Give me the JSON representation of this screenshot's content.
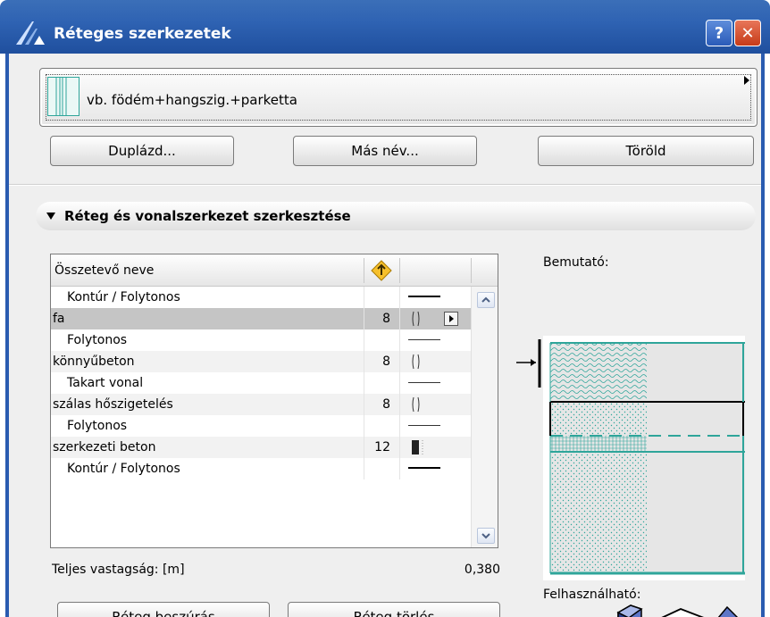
{
  "window": {
    "title": "Réteges szerkezetek",
    "help_label": "?",
    "close_label": "✕",
    "app_icon": "archicad-icon",
    "accent_color": "#2a5bb0"
  },
  "composite": {
    "name": "vb. födém+hangszig.+parketta",
    "swatch_icon": "composite-swatch-icon"
  },
  "buttons": {
    "duplicate": "Duplázd...",
    "rename": "Más név...",
    "delete": "Töröld",
    "insert_layer": "Réteg beszúrás",
    "remove_layer": "Réteg törlés"
  },
  "section": {
    "title": "Réteg és vonalszerkezet szerkesztése"
  },
  "table": {
    "header_name": "Összetevő neve",
    "header_icon": "core-priority-icon",
    "rows": [
      {
        "name": "Kontúr / Folytonos",
        "thickness": "",
        "kind": "line-thick"
      },
      {
        "name": "fa",
        "thickness": "8",
        "kind": "hatch",
        "selected": true
      },
      {
        "name": "Folytonos",
        "thickness": "",
        "kind": "line-thin"
      },
      {
        "name": "könnyűbeton",
        "thickness": "8",
        "kind": "hatch"
      },
      {
        "name": "Takart vonal",
        "thickness": "",
        "kind": "line-thin"
      },
      {
        "name": "szálas hőszigetelés",
        "thickness": "8",
        "kind": "hatch"
      },
      {
        "name": "Folytonos",
        "thickness": "",
        "kind": "line-thin"
      },
      {
        "name": "szerkezeti beton",
        "thickness": "12",
        "kind": "hatch-dark"
      },
      {
        "name": "Kontúr / Folytonos",
        "thickness": "",
        "kind": "line-thick"
      }
    ]
  },
  "total": {
    "label": "Teljes vastagság: [m]",
    "value": "0,380"
  },
  "preview": {
    "label": "Bemutató:",
    "usable_label": "Felhasználható:",
    "layer_color": "#2ea59a"
  },
  "usage_icons": [
    "wall-usage-icon",
    "slab-usage-icon",
    "roof-usage-icon"
  ]
}
